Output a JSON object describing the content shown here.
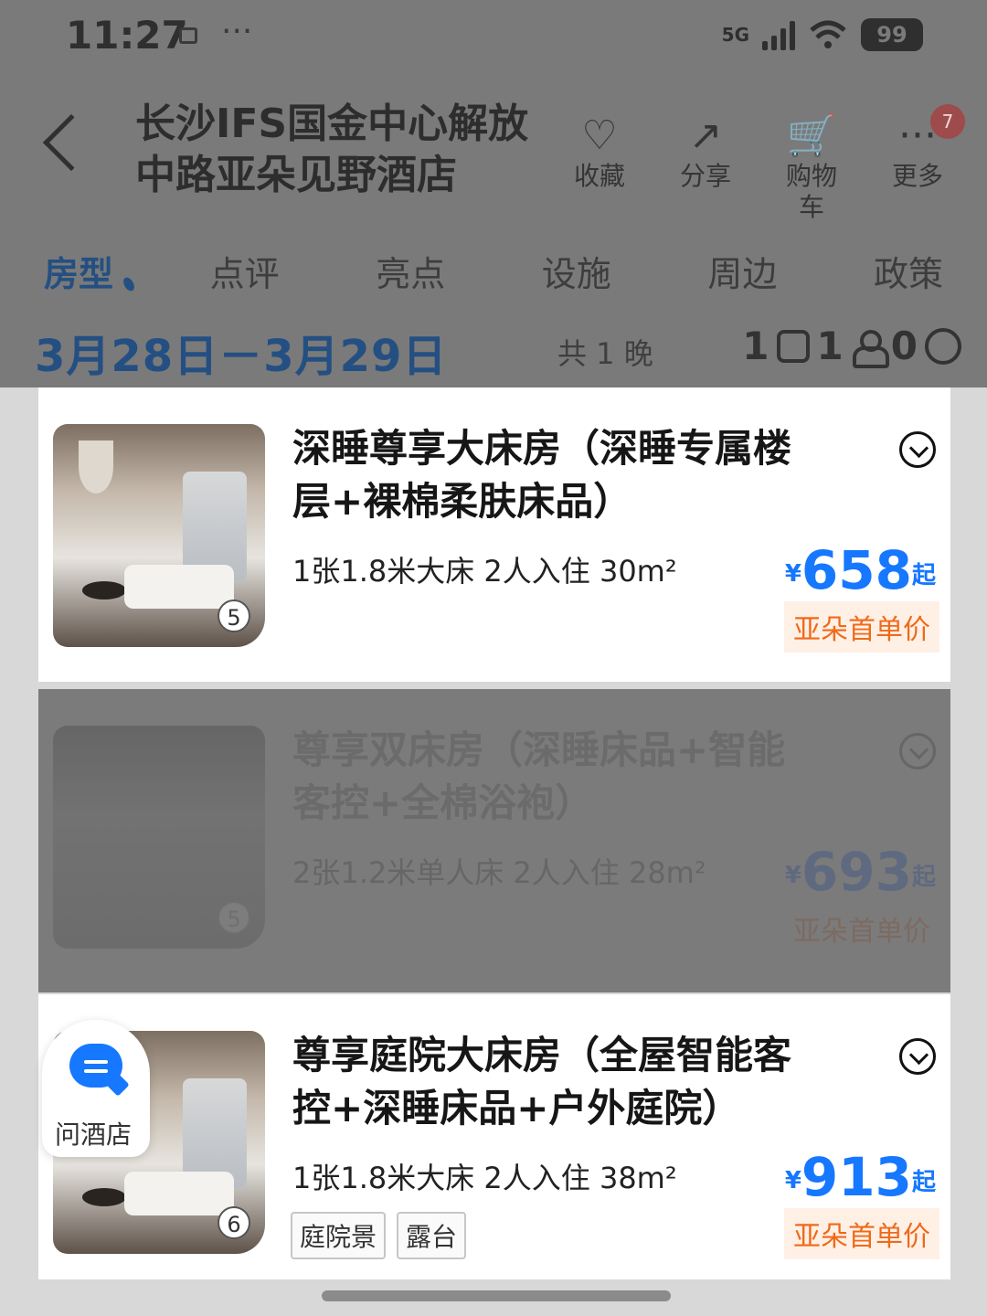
{
  "status": {
    "time": "11:27",
    "network": "5G",
    "battery": "99"
  },
  "header": {
    "title": "长沙IFS国金中心解放中路亚朵见野酒店",
    "actions": [
      {
        "label": "收藏",
        "icon": "heart-plus-icon"
      },
      {
        "label": "分享",
        "icon": "share-icon"
      },
      {
        "label": "购物车",
        "icon": "cart-icon"
      },
      {
        "label": "更多",
        "icon": "more-icon",
        "badge": "7"
      }
    ]
  },
  "tabs": [
    "房型",
    "点评",
    "亮点",
    "设施",
    "周边",
    "政策"
  ],
  "stay": {
    "date_range": "3月28日－3月29日",
    "nights": "共 1 晚",
    "rooms": "1",
    "adults": "1",
    "children": "0"
  },
  "rooms": [
    {
      "title": "深睡尊享大床房（深睡专属楼层+裸棉柔肤床品）",
      "meta": "1张1.8米大床  2人入住  30m²",
      "price_currency": "¥",
      "price": "658",
      "price_suffix": "起",
      "promo": "亚朵首单价",
      "photo_count": "5"
    },
    {
      "title": "尊享双床房（深睡床品+智能客控+全棉浴袍）",
      "meta": "2张1.2米单人床  2人入住  28m²",
      "price_currency": "¥",
      "price": "693",
      "price_suffix": "起",
      "promo": "亚朵首单价",
      "photo_count": "5"
    },
    {
      "title": "尊享庭院大床房（全屋智能客控+深睡床品+户外庭院）",
      "meta": "1张1.8米大床  2人入住  38m²",
      "price_currency": "¥",
      "price": "913",
      "price_suffix": "起",
      "promo": "亚朵首单价",
      "photo_count": "6",
      "tags": [
        "庭院景",
        "露台"
      ]
    }
  ],
  "ask_hotel": {
    "label": "问酒店"
  }
}
